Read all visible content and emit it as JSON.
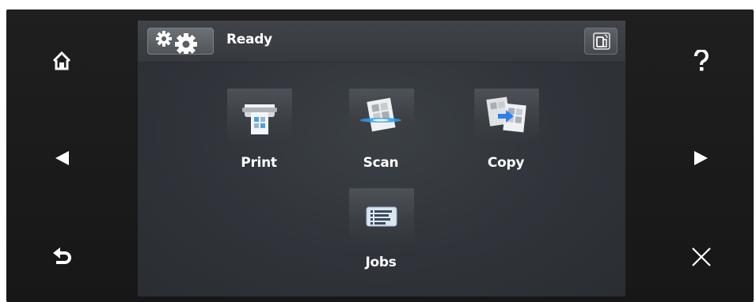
{
  "status": {
    "text": "Ready"
  },
  "apps": [
    {
      "label": "Print"
    },
    {
      "label": "Scan"
    },
    {
      "label": "Copy"
    },
    {
      "label": "Jobs"
    }
  ],
  "icons": {
    "home": "home-icon",
    "previous": "left-arrow-icon",
    "back": "back-icon",
    "help": "help-icon",
    "next": "right-arrow-icon",
    "cancel": "close-icon",
    "settings": "gear-icon",
    "mobile": "mobile-device-icon"
  },
  "colors": {
    "frame": "#1b1b1b",
    "screen": "#33373c",
    "text": "#ffffff",
    "scan_accent": "#2f9bf0",
    "copy_accent": "#2f7ff0"
  }
}
